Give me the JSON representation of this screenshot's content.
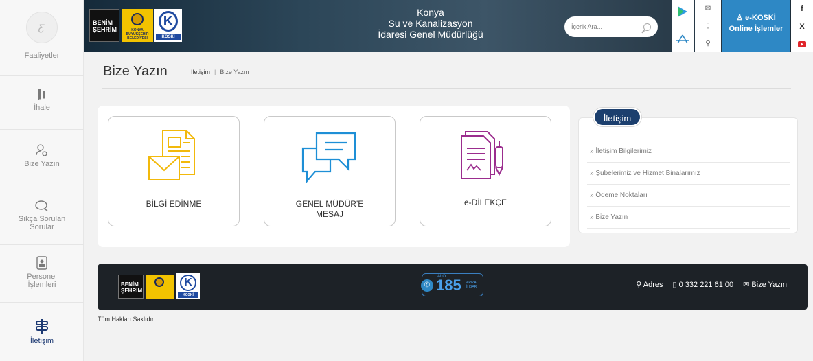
{
  "sidebar": {
    "top_label": "Faaliyetler",
    "items": [
      {
        "label": "İhale",
        "icon": "bookmark-icon"
      },
      {
        "label": "Bize Yazın",
        "icon": "user-settings-icon"
      },
      {
        "label": "Sıkça Sorulan Sorular",
        "icon": "chat-icon"
      },
      {
        "label": "Personel İşlemleri",
        "icon": "id-card-icon"
      },
      {
        "label": "İletişim",
        "icon": "signpost-icon"
      }
    ]
  },
  "header": {
    "title_line1": "Konya",
    "title_line2": "Su ve Kanalizasyon",
    "title_line3": "İdaresi Genel Müdürlüğü",
    "search_placeholder": "İçerik Ara...",
    "ekoski_line1": "e-KOSKİ",
    "ekoski_line2": "Online İşlemler",
    "logo_benim_line1": "BENİM",
    "logo_benim_line2": "ŞEHRİM",
    "logo_kbb": "KONYA BÜYÜKŞEHİR BELEDİYESİ",
    "logo_koski": "KOSKİ",
    "social": [
      "f",
      "X"
    ]
  },
  "page": {
    "title": "Bize Yazın",
    "breadcrumb_1": "İletişim",
    "breadcrumb_sep": "|",
    "breadcrumb_2": "Bize Yazın"
  },
  "cards": [
    {
      "label": "BİLGİ EDİNME",
      "icon": "document-envelope-icon",
      "color": "#f2b90c"
    },
    {
      "label_line1": "GENEL MÜDÜR'E",
      "label_line2": "MESAJ",
      "icon": "chat-bubbles-icon",
      "color": "#1e8fd6"
    },
    {
      "label": "e-DİLEKÇE",
      "icon": "petition-pen-icon",
      "color": "#9b2d8e"
    }
  ],
  "contact_panel": {
    "tab": "İletişim",
    "links": [
      "» İletişim Bilgilerimiz",
      "» Şubelerimiz ve Hizmet Binalarımız",
      "» Ödeme Noktaları",
      "» Bize Yazın"
    ]
  },
  "footer": {
    "alo_label": "ALO",
    "alo_number": "185",
    "alo_sub1": "ARIZA",
    "alo_sub2": "İHBAR",
    "address": "Adres",
    "phone": "0 332 221 61 00",
    "write": "Bize Yazın",
    "rights": "Tüm Hakları Saklıdır."
  },
  "colors": {
    "accent": "#1c3f6e",
    "ekoski": "#2e88c5",
    "footer": "#1d2227"
  }
}
